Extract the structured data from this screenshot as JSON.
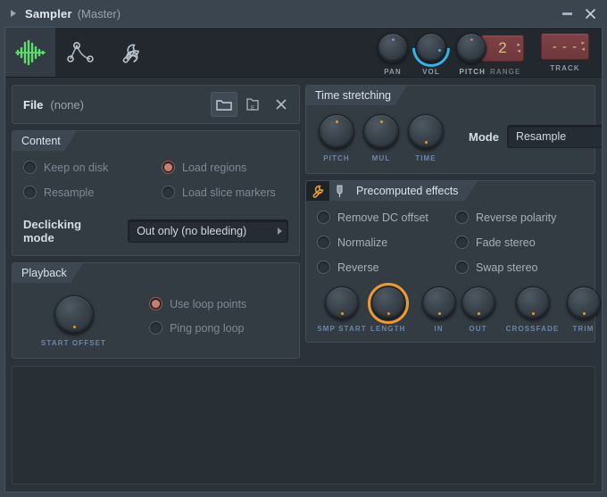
{
  "window": {
    "title": "Sampler",
    "subtitle": "(Master)",
    "expand_arrow_icon": "triangle-right-icon",
    "minimize_label": "minimize-icon",
    "close_label": "close-icon"
  },
  "tabs": [
    {
      "name": "sample",
      "icon": "waveform-icon",
      "active": true
    },
    {
      "name": "envelope",
      "icon": "envelope-curve-icon",
      "active": false
    },
    {
      "name": "misc",
      "icon": "wrench-icon",
      "active": false
    }
  ],
  "top_controls": {
    "pan": {
      "label": "PAN",
      "indicator_color": "#9b7fd4"
    },
    "vol": {
      "label": "VOL",
      "arc_color": "#33b4e8"
    },
    "pitch": {
      "label": "PITCH",
      "indicator_color": "#e06a5a"
    },
    "range": {
      "label": "RANGE",
      "value": "2"
    },
    "track": {
      "label": "TRACK",
      "value": "- - -"
    }
  },
  "file": {
    "label": "File",
    "value": "(none)",
    "buttons": [
      {
        "name": "open-file-button",
        "icon": "folder-open-icon"
      },
      {
        "name": "save-file-button",
        "icon": "folder-export-icon"
      },
      {
        "name": "clear-file-button",
        "icon": "close-icon"
      }
    ]
  },
  "content": {
    "title": "Content",
    "options": [
      {
        "label": "Keep on disk",
        "checked": false
      },
      {
        "label": "Load regions",
        "checked": true
      },
      {
        "label": "Resample",
        "checked": false
      },
      {
        "label": "Load slice markers",
        "checked": false
      }
    ],
    "declicking": {
      "label": "Declicking mode",
      "value": "Out only (no bleeding)"
    }
  },
  "playback": {
    "title": "Playback",
    "start_offset": {
      "label": "START OFFSET"
    },
    "options": [
      {
        "label": "Use loop points",
        "checked": true
      },
      {
        "label": "Ping pong loop",
        "checked": false
      }
    ]
  },
  "time_stretching": {
    "title": "Time stretching",
    "knobs": [
      {
        "label": "PITCH"
      },
      {
        "label": "MUL"
      },
      {
        "label": "TIME"
      }
    ],
    "mode": {
      "label": "Mode",
      "value": "Resample"
    }
  },
  "precomputed_effects": {
    "title": "Precomputed effects",
    "header_icons": [
      {
        "name": "wrench-icon",
        "color": "#f0a52c"
      },
      {
        "name": "pin-icon",
        "color": "#aab6c2"
      }
    ],
    "options": [
      {
        "label": "Remove DC offset",
        "checked": false
      },
      {
        "label": "Reverse polarity",
        "checked": false
      },
      {
        "label": "Normalize",
        "checked": false
      },
      {
        "label": "Fade stereo",
        "checked": false
      },
      {
        "label": "Reverse",
        "checked": false
      },
      {
        "label": "Swap stereo",
        "checked": false
      }
    ],
    "knobs": [
      {
        "label": "SMP START",
        "highlighted": false
      },
      {
        "label": "LENGTH",
        "highlighted": true
      },
      {
        "label": "IN",
        "highlighted": false
      },
      {
        "label": "OUT",
        "highlighted": false
      },
      {
        "label": "CROSSFADE",
        "highlighted": false
      },
      {
        "label": "TRIM",
        "highlighted": false
      }
    ]
  },
  "waveform_display": {
    "name": "waveform-display",
    "content": ""
  },
  "colors": {
    "window_bg": "#3b4550",
    "client_bg": "#2b3239",
    "group_bg": "#333b43",
    "accent_green": "#5ce06a",
    "accent_orange": "#f0992c",
    "accent_blue": "#33b4e8",
    "radio_on": "#cd7d6b",
    "display_red": "#7e4146",
    "display_text": "#d9c08a"
  }
}
